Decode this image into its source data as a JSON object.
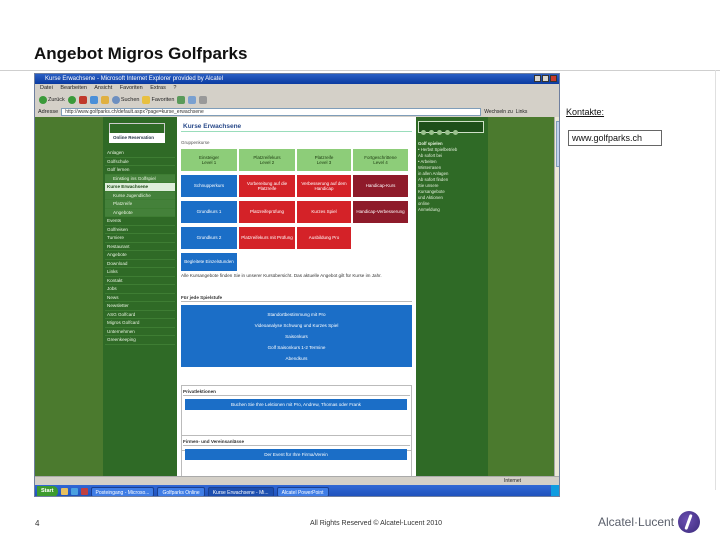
{
  "slide": {
    "title": "Angebot Migros Golfparks",
    "page_number": "4",
    "copyright": "All Rights Reserved © Alcatel-Lucent 2010",
    "logo_text": "Alcatel·Lucent"
  },
  "annotations": {
    "kontakte": "Kontakte:",
    "website": "www.golfparks.ch"
  },
  "browser": {
    "title": "Kurse Erwachsene - Microsoft Internet Explorer provided by Alcatel",
    "menu": [
      "Datei",
      "Bearbeiten",
      "Ansicht",
      "Favoriten",
      "Extras",
      "?"
    ],
    "toolbar": {
      "back": "Zurück",
      "search": "Suchen",
      "favorites": "Favoriten"
    },
    "address_label": "Adresse",
    "address_value": "http://www.golfparks.ch/default.aspx?page=kurse_erwachsene",
    "go_label": "Wechseln zu",
    "links_label": "Links",
    "status_right": "Internet",
    "taskbar": {
      "start": "Start",
      "items": [
        "Posteingang - Microso...",
        "Golfparks Online",
        "Kurse Erwachsene - Mi...",
        "Alcatel PowerPoint"
      ]
    }
  },
  "site": {
    "online_reservation": "Online Reservation",
    "nav": [
      {
        "label": "Anlagen",
        "type": "normal"
      },
      {
        "label": "Golfschule",
        "type": "normal"
      },
      {
        "label": "Golf lernen",
        "type": "normal"
      },
      {
        "label": "Einstieg ins Golfspiel",
        "type": "sub"
      },
      {
        "label": "Kurse Erwachsene",
        "type": "act"
      },
      {
        "label": "Kurse Jugendliche",
        "type": "sub"
      },
      {
        "label": "Platzreife",
        "type": "sub"
      },
      {
        "label": "Angebote",
        "type": "sub"
      },
      {
        "label": "Events",
        "type": "normal"
      },
      {
        "label": "Golfreisen",
        "type": "normal"
      },
      {
        "label": "Turniere",
        "type": "normal"
      },
      {
        "label": "Restaurant",
        "type": "normal"
      },
      {
        "label": "Angebote",
        "type": "normal"
      },
      {
        "label": "Download",
        "type": "normal"
      },
      {
        "label": "Links",
        "type": "normal"
      },
      {
        "label": "Kontakt",
        "type": "normal"
      },
      {
        "label": "Jobs",
        "type": "normal"
      },
      {
        "label": "News",
        "type": "normal"
      },
      {
        "label": "Newsletter",
        "type": "normal"
      },
      {
        "label": "ASG Golfcard",
        "type": "normal"
      },
      {
        "label": "Migros Golfcard",
        "type": "normal"
      },
      {
        "label": "Unternehmen",
        "type": "normal"
      },
      {
        "label": "Greenkeeping",
        "type": "normal"
      }
    ],
    "right_panel": {
      "heading": "Golf spielen",
      "lines": [
        "• Herbst Spielbetrieb",
        "  Ab sofort bei",
        "• Arbeiten",
        "  Winterrasen",
        "  in allen Anlagen",
        "Ab sofort finden",
        "Sie unsere",
        "Kursangebote",
        "und Aktionen",
        "online",
        "Anmeldung"
      ]
    },
    "main": {
      "heading": "Kurse Erwachsene",
      "group_label": "Gruppenkurse",
      "levels": [
        "Einsteiger\nLevel 1",
        "Platzreifekurs\nLevel 2",
        "Platzreife\nLevel 3",
        "Fortgeschrittene\nLevel 4"
      ],
      "rows": [
        [
          "Schnupperkurs",
          "Vorbereitung auf die Platzreife",
          "Verbesserung auf dem Handicap",
          "Handicap-Kurs"
        ],
        [
          "Grundkurs 1",
          "Platzreifeprüfung",
          "Kurzes Spiel",
          "Handicap-Verbesserung"
        ],
        [
          "Grundkurs 2",
          "Platzreifekurs mit Prüfung",
          "Ausbildung Pro",
          ""
        ]
      ],
      "single": "Begleitete Einzelstunden",
      "note": "Alle Kursangebote finden Sie in unserer Kursübersicht. Das aktuelle Angebot gilt für Kurse im Jahr.",
      "section1": "Für jede Spielstufe",
      "section1_lines": [
        "Standortbestimmung mit Pro",
        "Videoanalyse Schwung und Kurzes Spiel",
        "Saisonkurs",
        "Golf Saisonkurs 1-2 Termine",
        "Abendkurs"
      ],
      "section2": "Privatlektionen",
      "section2_line": "Buchen Sie Ihre Lektionen mit Pro, Andrew, Thomas oder Frank",
      "section3": "Firmen- und Vereinsanlässe",
      "section3_line": "Der Event für Ihre Firma/Verein"
    }
  },
  "colors": {
    "site_green": "#2f6a26",
    "level_green": "#8dcd79",
    "course_blue": "#1b6ec7",
    "course_red": "#d42228",
    "course_darkred": "#8e1b2a"
  }
}
